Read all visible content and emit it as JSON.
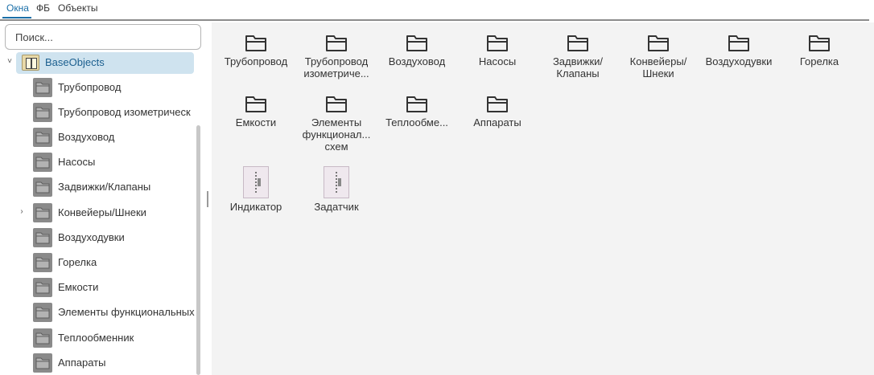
{
  "tabs": [
    {
      "label": "Окна",
      "active": true
    },
    {
      "label": "ФБ",
      "active": false
    },
    {
      "label": "Объекты",
      "active": false
    }
  ],
  "search": {
    "placeholder": "Поиск..."
  },
  "tree": {
    "root": {
      "label": "BaseObjects",
      "icon": "base-objects-icon",
      "expanded": true
    },
    "items": [
      {
        "label": "Трубопровод"
      },
      {
        "label": "Трубопровод изометрическ"
      },
      {
        "label": "Воздуховод"
      },
      {
        "label": "Насосы"
      },
      {
        "label": "Задвижки/Клапаны"
      },
      {
        "label": "Конвейеры/Шнеки",
        "expandable": true
      },
      {
        "label": "Воздуходувки"
      },
      {
        "label": "Горелка"
      },
      {
        "label": "Емкости"
      },
      {
        "label": "Элементы функциональных"
      },
      {
        "label": "Теплообменник"
      },
      {
        "label": "Аппараты"
      }
    ]
  },
  "grid": {
    "folders": [
      {
        "label": "Трубопровод"
      },
      {
        "label": "Трубопровод изометриче..."
      },
      {
        "label": "Воздуховод"
      },
      {
        "label": "Насосы"
      },
      {
        "label": "Задвижки/ Клапаны"
      },
      {
        "label": "Конвейеры/ Шнеки"
      },
      {
        "label": "Воздуходувки"
      },
      {
        "label": "Горелка"
      },
      {
        "label": "Емкости"
      },
      {
        "label": "Элементы функционал... схем"
      },
      {
        "label": "Теплообме..."
      },
      {
        "label": "Аппараты"
      }
    ],
    "objects": [
      {
        "label": "Индикатор"
      },
      {
        "label": "Задатчик"
      }
    ]
  },
  "colors": {
    "accent": "#1a6fa8",
    "selection": "#cfe3ef",
    "content_bg": "#f3f3f3",
    "folder_tile": "#8a8a8a"
  }
}
